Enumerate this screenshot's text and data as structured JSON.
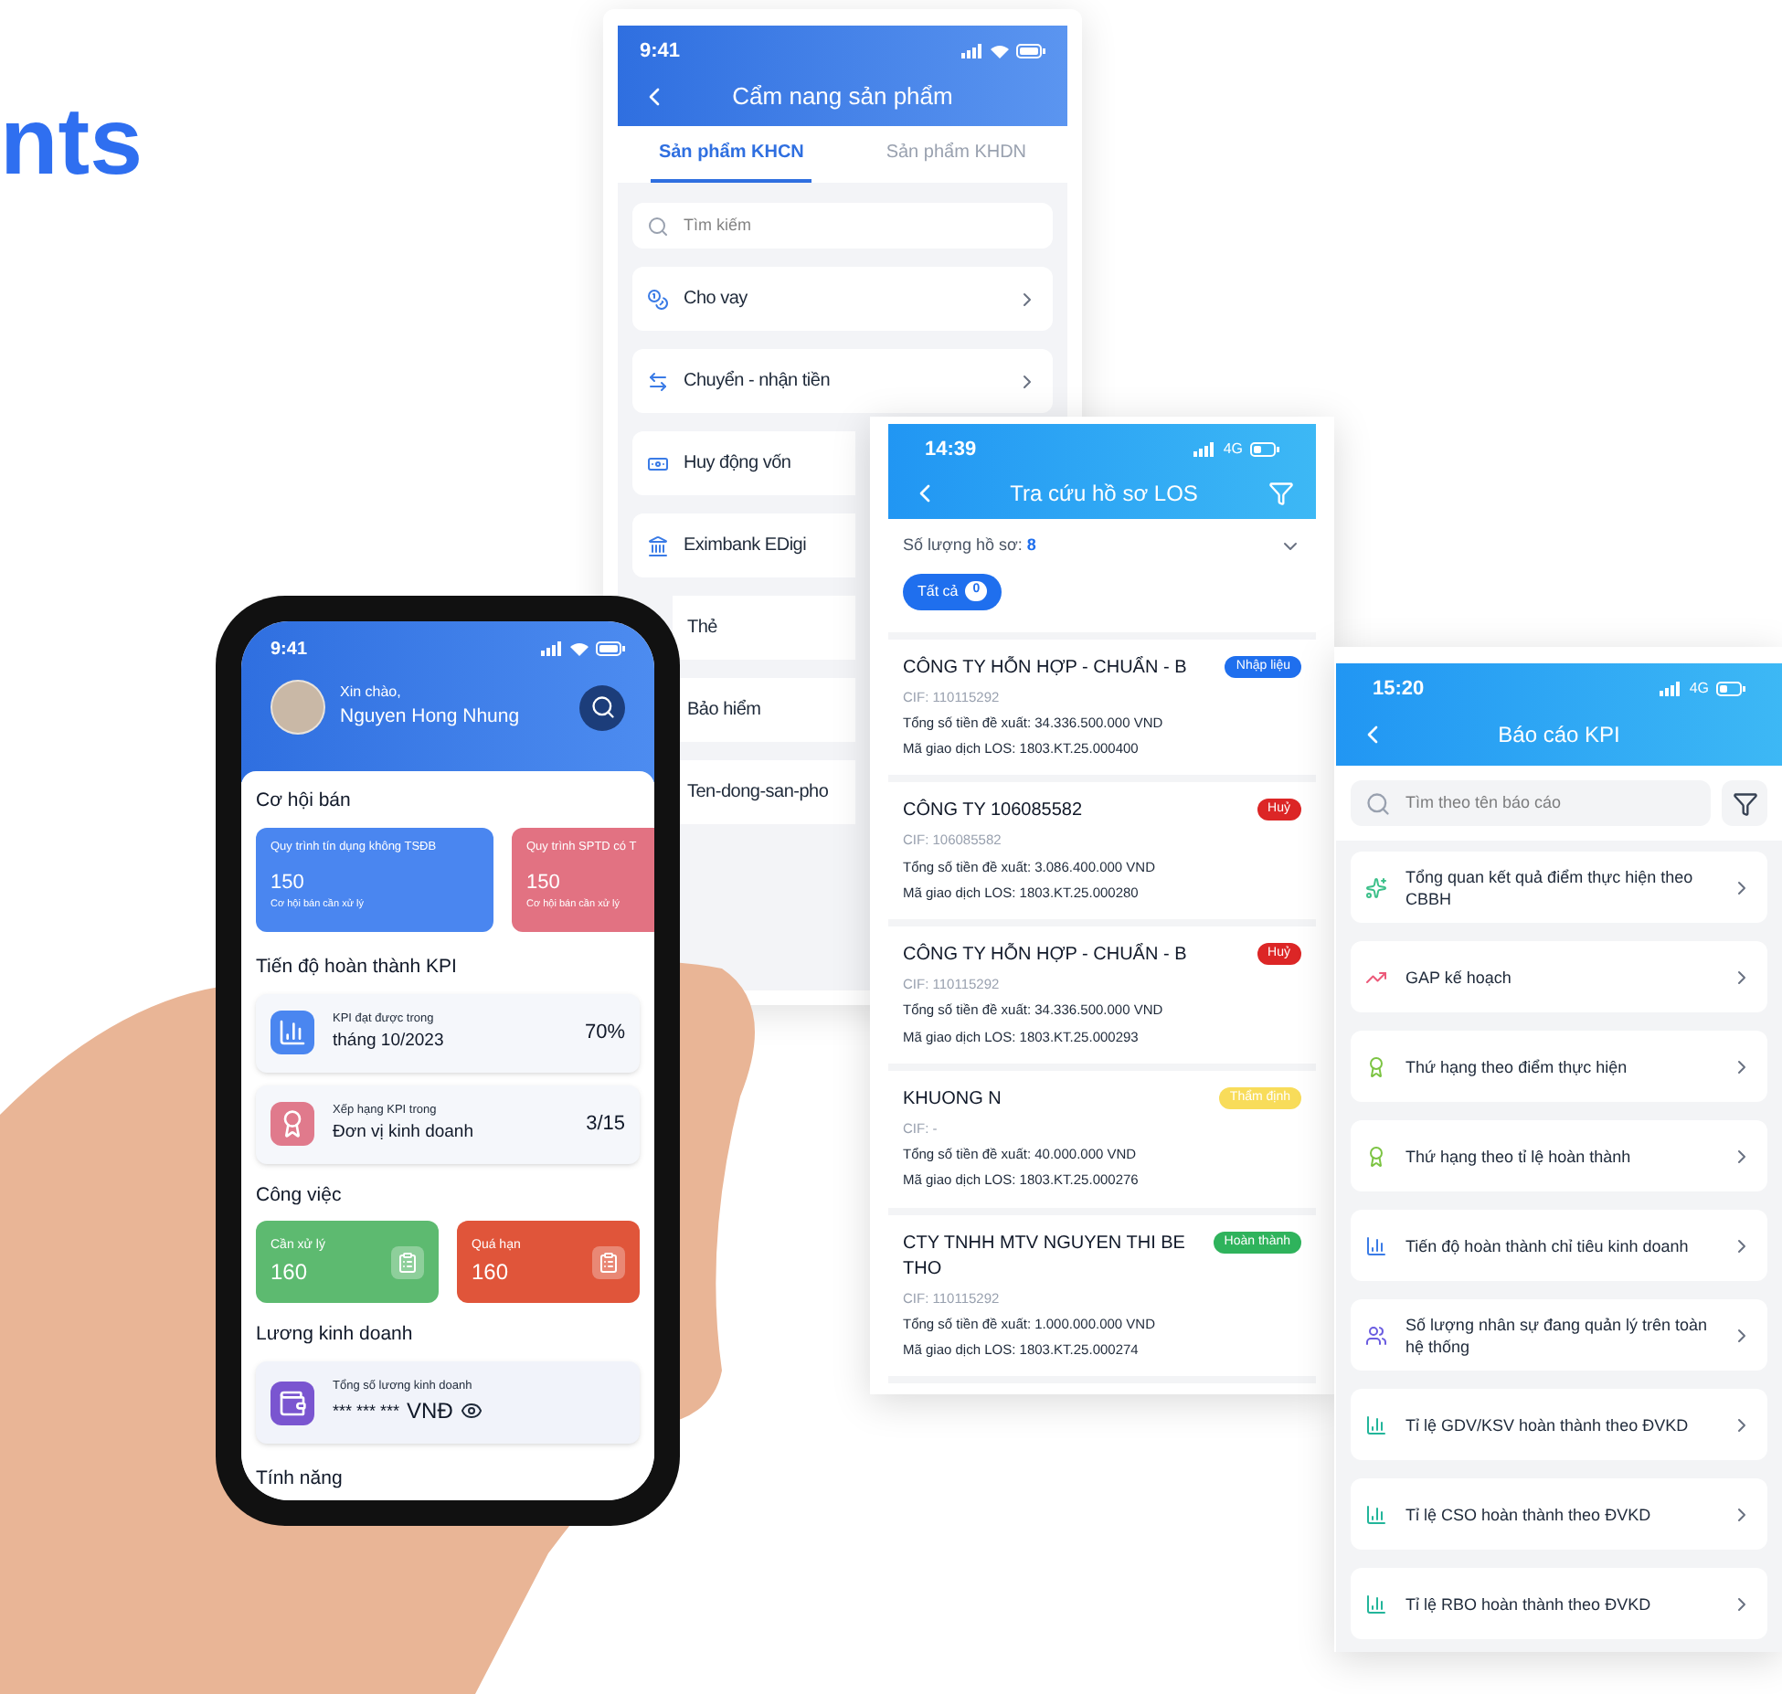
{
  "heading": "nts",
  "product_guide": {
    "time": "9:41",
    "title": "Cẩm nang sản phẩm",
    "tabs": [
      {
        "label": "Sản phẩm KHCN",
        "selected": true
      },
      {
        "label": "Sản phẩm KHDN",
        "selected": false
      }
    ],
    "search": {
      "placeholder": "Tìm kiếm"
    },
    "items": [
      {
        "label": "Cho vay",
        "kind": "loan"
      },
      {
        "label": "Chuyển - nhận tiền",
        "kind": "transfer"
      },
      {
        "label": "Huy động vốn",
        "kind": "deposit"
      },
      {
        "label": "Eximbank EDigi",
        "kind": "bank"
      },
      {
        "label": "Thẻ",
        "kind": "hidden"
      },
      {
        "label": "Bảo hiểm",
        "kind": "hidden"
      },
      {
        "label": "Ten-dong-san-pho",
        "kind": "hidden"
      }
    ]
  },
  "los_lookup": {
    "time": "14:39",
    "network": "4G",
    "title": "Tra cứu hồ sơ LOS",
    "count_label": "Số lượng hồ sơ:",
    "count": "8",
    "chips": [
      {
        "label": "Tất cả",
        "count": "0",
        "selected": true
      }
    ],
    "records": [
      {
        "name": "CÔNG TY HỖN HỢP - CHUẨN - B",
        "cif": "CIF: 110115292",
        "amount": "Tổng số tiền đề xuất: 34.336.500.000 VND",
        "code": "Mã giao dịch LOS: 1803.KT.25.000400",
        "status": "Nhập liệu",
        "color": "#1f6fee"
      },
      {
        "name": "CÔNG TY 106085582",
        "cif": "CIF: 106085582",
        "amount": "Tổng số tiền đề xuất: 3.086.400.000 VND",
        "code": "Mã giao dịch LOS: 1803.KT.25.000280",
        "status": "Huỷ",
        "color": "#dc2626"
      },
      {
        "name": "CÔNG TY HỖN HỢP - CHUẨN - B",
        "cif": "CIF: 110115292",
        "amount": "Tổng số tiền đề xuất: 34.336.500.000 VND",
        "code": "Mã giao dịch LOS: 1803.KT.25.000293",
        "status": "Huỷ",
        "color": "#dc2626"
      },
      {
        "name": "KHUONG N",
        "cif": "CIF: -",
        "amount": "Tổng số tiền đề xuất: 40.000.000 VND",
        "code": "Mã giao dịch LOS: 1803.KT.25.000276",
        "status": "Thẩm định",
        "color": "#f8dc5a"
      },
      {
        "name": "CTY TNHH MTV NGUYEN THI BE THO",
        "cif": "CIF: 110115292",
        "amount": "Tổng số tiền đề xuất: 1.000.000.000 VND",
        "code": "Mã giao dịch LOS: 1803.KT.25.000274",
        "status": "Hoàn thành",
        "color": "#2fb35c"
      }
    ]
  },
  "kpi_reports": {
    "time": "15:20",
    "network": "4G",
    "title": "Báo cáo KPI",
    "search": {
      "placeholder": "Tìm theo tên báo cáo"
    },
    "items": [
      {
        "label": "Tổng quan kết quả điểm thực hiện theo CBBH",
        "kind": "star"
      },
      {
        "label": "GAP kế hoạch",
        "kind": "gap"
      },
      {
        "label": "Thứ hạng theo điểm thực hiện",
        "kind": "medal"
      },
      {
        "label": "Thứ hạng theo tỉ lệ hoàn thành",
        "kind": "medal"
      },
      {
        "label": "Tiến độ hoàn thành chỉ tiêu kinh doanh",
        "kind": "bars"
      },
      {
        "label": "Số lượng nhân sự đang quản lý trên toàn hệ thống",
        "kind": "people"
      },
      {
        "label": "Tỉ lệ GDV/KSV hoàn thành theo ĐVKD",
        "kind": "ratio"
      },
      {
        "label": "Tỉ lệ CSO hoàn thành theo ĐVKD",
        "kind": "ratio"
      },
      {
        "label": "Tỉ lệ RBO hoàn thành theo ĐVKD",
        "kind": "ratio"
      }
    ]
  },
  "home": {
    "time": "9:41",
    "greeting": "Xin chào,",
    "user_name": "Nguyen Hong Nhung",
    "opportunities": {
      "title": "Cơ hội bán",
      "cards": [
        {
          "title": "Quy trình tín dụng không TSĐB",
          "value": "150",
          "caption": "Cơ hội bán cần xử lý",
          "color": "#4a86f0"
        },
        {
          "title": "Quy trình SPTD có T",
          "value": "150",
          "caption": "Cơ hội bán cần xử lý",
          "color": "#e27282"
        }
      ]
    },
    "kpi": {
      "title": "Tiến độ hoàn thành KPI",
      "rows": [
        {
          "label": "KPI đạt được trong",
          "value": "tháng 10/2023",
          "figure": "70%",
          "kind": "chart"
        },
        {
          "label": "Xếp hạng KPI trong",
          "value": "Đơn vị kinh doanh",
          "figure": "3/15",
          "kind": "rank"
        }
      ]
    },
    "tasks": {
      "title": "Công việc",
      "cards": [
        {
          "label": "Cần xử lý",
          "value": "160",
          "color": "#5dba70"
        },
        {
          "label": "Quá hạn",
          "value": "160",
          "color": "#e0553a"
        }
      ]
    },
    "salary": {
      "title": "Lương kinh doanh",
      "label": "Tổng số lương kinh doanh",
      "masked": "*** *** ***",
      "currency": "VNĐ"
    },
    "features": {
      "title": "Tính năng"
    }
  }
}
